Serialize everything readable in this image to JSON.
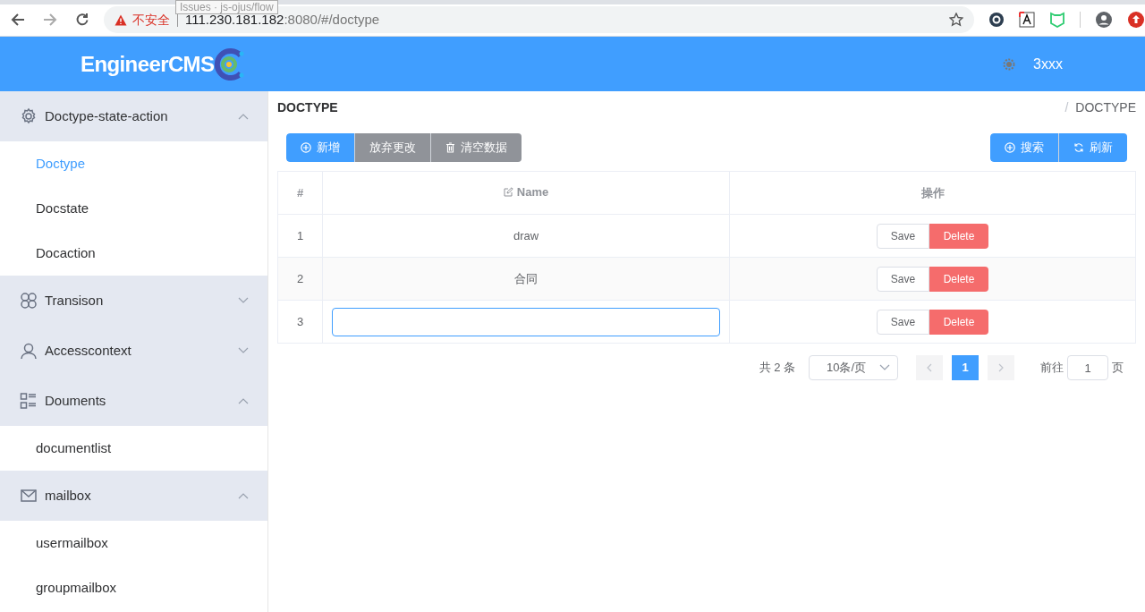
{
  "browser": {
    "tooltip": "Issues · js-ojus/flow",
    "security_label": "不安全",
    "url_host": "111.230.181.182",
    "url_rest": ":8080/#/doctype"
  },
  "header": {
    "logo": "EngineerCMS",
    "user": "3xxx"
  },
  "sidebar": {
    "groups": [
      {
        "label": "Doctype-state-action",
        "kind": "settings",
        "expanded": true,
        "children": [
          {
            "label": "Doctype",
            "selected": true
          },
          {
            "label": "Docstate",
            "selected": false
          },
          {
            "label": "Docaction",
            "selected": false
          }
        ]
      },
      {
        "label": "Transison",
        "kind": "transitions",
        "expanded": false
      },
      {
        "label": "Accesscontext",
        "kind": "access",
        "expanded": false
      },
      {
        "label": "Douments",
        "kind": "documents",
        "expanded": true,
        "children": [
          {
            "label": "documentlist",
            "selected": false
          }
        ]
      },
      {
        "label": "mailbox",
        "kind": "mail",
        "expanded": true,
        "children": [
          {
            "label": "usermailbox",
            "selected": false
          },
          {
            "label": "groupmailbox",
            "selected": false
          }
        ]
      }
    ]
  },
  "page": {
    "title": "DOCTYPE",
    "breadcrumb_separator": "/",
    "breadcrumb": "DOCTYPE"
  },
  "toolbar_left": [
    {
      "label": "新增",
      "kind": "add"
    },
    {
      "label": "放弃更改",
      "kind": "discard"
    },
    {
      "label": "清空数据",
      "kind": "clear"
    }
  ],
  "toolbar_right": [
    {
      "label": "搜索",
      "kind": "search"
    },
    {
      "label": "刷新",
      "kind": "refresh"
    }
  ],
  "table": {
    "columns": [
      "#",
      "Name",
      "操作"
    ],
    "rows": [
      {
        "index": "1",
        "name": "draw",
        "editing": false,
        "save": "Save",
        "delete": "Delete"
      },
      {
        "index": "2",
        "name": "合同",
        "editing": false,
        "save": "Save",
        "delete": "Delete"
      },
      {
        "index": "3",
        "name": "",
        "editing": true,
        "save": "Save",
        "delete": "Delete"
      }
    ]
  },
  "pagination": {
    "total": "共 2 条",
    "page_size": "10条/页",
    "pages": [
      {
        "label": "1",
        "selected": true
      }
    ],
    "goto_label": "前往",
    "goto_value": "1",
    "page_suffix": "页"
  }
}
